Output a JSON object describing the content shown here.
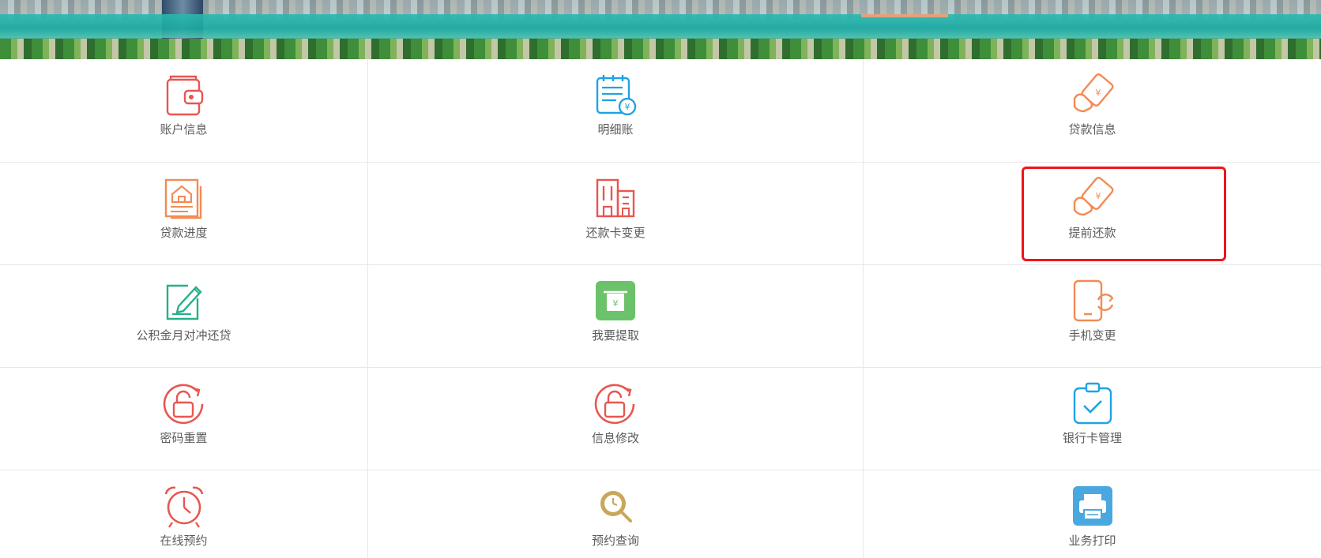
{
  "banner": {
    "description_icon": "city-river-panorama-image"
  },
  "colors": {
    "red": "#e85650",
    "blue": "#1fa3e4",
    "orange": "#f28b54",
    "green": "#27b089",
    "lime": "#6cc26a",
    "gold": "#c9a75a",
    "sky": "#4aa8e0",
    "highlight": "#f0141b"
  },
  "menu": {
    "rows": [
      [
        {
          "label": "账户信息",
          "icon": "wallet-icon"
        },
        {
          "label": "明细账",
          "icon": "ledger-yuan-icon"
        },
        {
          "label": "贷款信息",
          "icon": "loan-hand-card-icon"
        }
      ],
      [
        {
          "label": "贷款进度",
          "icon": "house-document-icon"
        },
        {
          "label": "还款卡变更",
          "icon": "buildings-icon"
        },
        {
          "label": "提前还款",
          "icon": "loan-hand-card-icon"
        }
      ],
      [
        {
          "label": "公积金月对冲还贷",
          "icon": "edit-pen-icon"
        },
        {
          "label": "我要提取",
          "icon": "atm-withdraw-icon"
        },
        {
          "label": "手机变更",
          "icon": "phone-refresh-icon"
        }
      ],
      [
        {
          "label": "密码重置",
          "icon": "unlock-refresh-icon"
        },
        {
          "label": "信息修改",
          "icon": "unlock-refresh-icon"
        },
        {
          "label": "银行卡管理",
          "icon": "clipboard-check-icon"
        }
      ],
      [
        {
          "label": "在线预约",
          "icon": "alarm-clock-icon"
        },
        {
          "label": "预约查询",
          "icon": "search-clock-icon"
        },
        {
          "label": "业务打印",
          "icon": "printer-icon"
        }
      ]
    ]
  }
}
